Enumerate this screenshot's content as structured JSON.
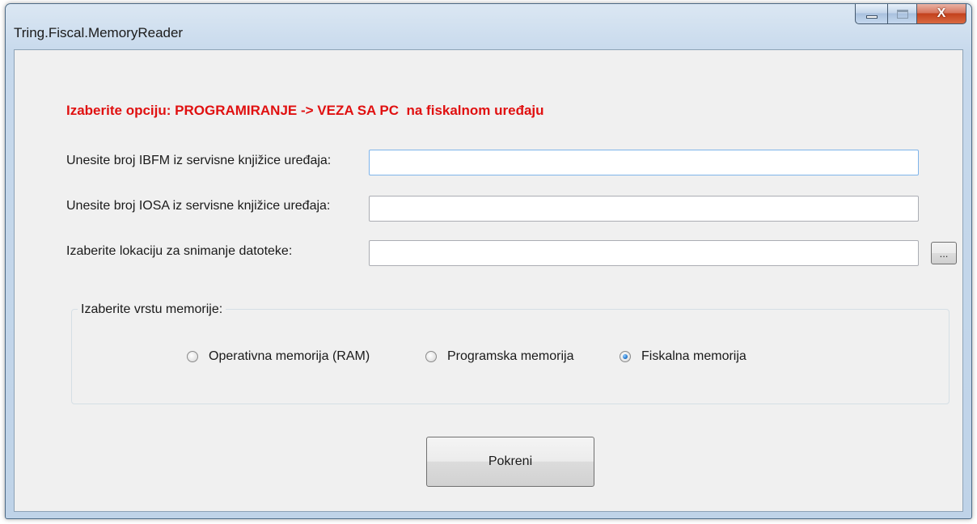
{
  "window": {
    "title": "Tring.Fiscal.MemoryReader",
    "close_glyph": "X"
  },
  "instruction": "Izaberite opciju: PROGRAMIRANJE -> VEZA SA PC  na fiskalnom uređaju",
  "fields": {
    "ibfm": {
      "label": "Unesite broj IBFM iz servisne knjižice uređaja:",
      "value": ""
    },
    "iosa": {
      "label": "Unesite broj IOSA iz servisne knjižice uređaja:",
      "value": ""
    },
    "location": {
      "label": "Izaberite lokaciju za snimanje datoteke:",
      "value": "",
      "browse_label": "..."
    }
  },
  "memory_group": {
    "legend": "Izaberite vrstu memorije:",
    "options": [
      {
        "label": "Operativna memorija (RAM)",
        "checked": false
      },
      {
        "label": "Programska memorija",
        "checked": false
      },
      {
        "label": "Fiskalna memorija",
        "checked": true
      }
    ]
  },
  "run_button": "Pokreni",
  "colors": {
    "instruction": "#e01010",
    "client_bg": "#f0f0f0",
    "frame": "#c7d9ec",
    "close_button": "#c3411c"
  },
  "icons": [
    "minimize-icon",
    "maximize-icon",
    "close-icon"
  ]
}
